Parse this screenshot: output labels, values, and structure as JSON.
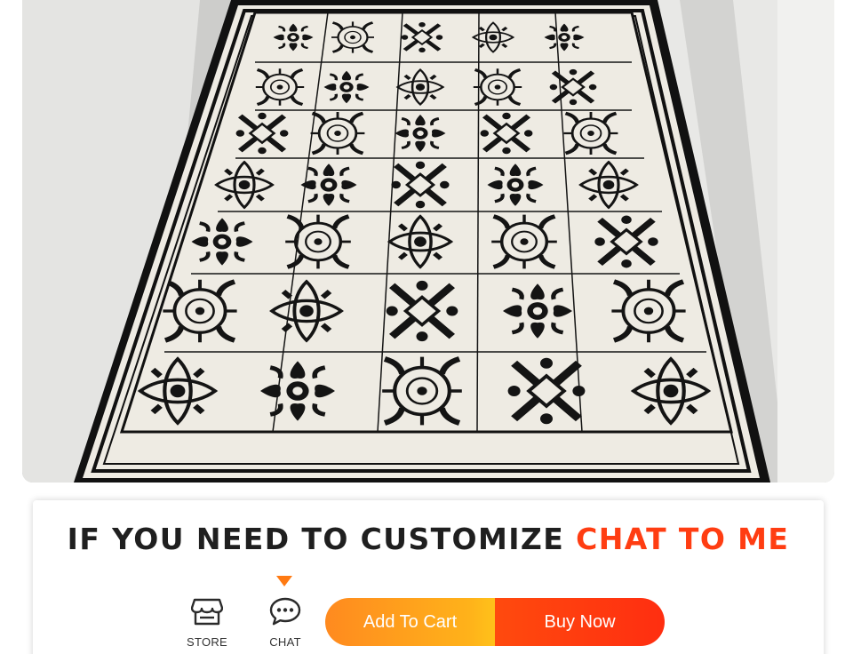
{
  "product_image": {
    "alt": "",
    "colors": {
      "rug_border": "#111111",
      "rug_field": "#eeebe3",
      "motif": "#141414",
      "floor": "#cdcdcb"
    }
  },
  "banner": {
    "headline_part1": "IF YOU NEED TO CUSTOMIZE ",
    "headline_part2": "CHAT TO ME",
    "colors": {
      "headline_dark": "#1f1f1f",
      "headline_accent": "#ff3d12",
      "pointer": "#ff7a12"
    }
  },
  "actions": {
    "store": {
      "label": "STORE",
      "icon": "store-icon"
    },
    "chat": {
      "label": "CHAT",
      "icon": "chat-bubble-icon"
    },
    "add_to_cart": "Add To Cart",
    "buy_now": "Buy Now",
    "colors": {
      "cart_gradient_start": "#ff8a1f",
      "cart_gradient_end": "#ffc21a",
      "buy_color": "#ff2e10"
    }
  }
}
